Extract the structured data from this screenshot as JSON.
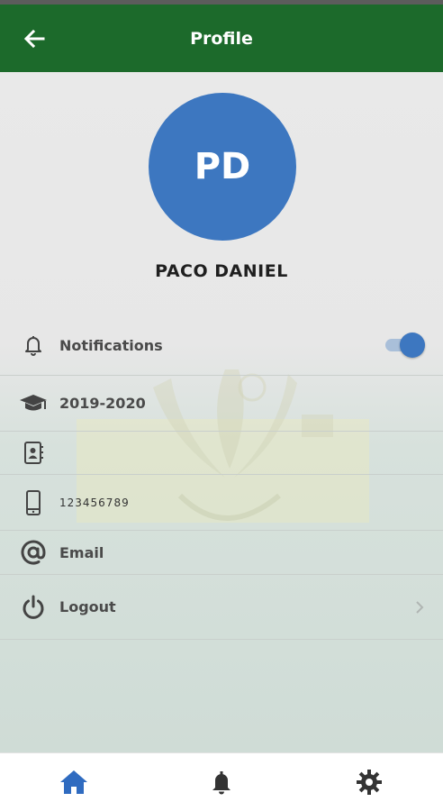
{
  "header": {
    "title": "Profile",
    "back_icon": "arrow-back-icon",
    "color": "#1c6a2b"
  },
  "profile": {
    "initials": "PD",
    "name": "PACO DANIEL",
    "avatar_color": "#3d77c0"
  },
  "rows": {
    "notifications": {
      "icon": "bell-icon",
      "label": "Notifications",
      "toggle_on": true
    },
    "school_year": {
      "icon": "graduation-cap-icon",
      "label": "2019-2020"
    },
    "contact": {
      "icon": "contact-card-icon",
      "label": ""
    },
    "phone": {
      "icon": "phone-icon",
      "label": "123456789"
    },
    "email": {
      "icon": "at-icon",
      "label": "Email"
    },
    "logout": {
      "icon": "power-icon",
      "label": "Logout",
      "trailing_icon": "chevron-right-icon"
    }
  },
  "bottom_nav": {
    "items": [
      {
        "icon": "home-icon",
        "active": true
      },
      {
        "icon": "bell-icon",
        "active": false
      },
      {
        "icon": "gear-icon",
        "active": false
      }
    ],
    "active_color": "#2f6bc0",
    "inactive_color": "#333333"
  }
}
